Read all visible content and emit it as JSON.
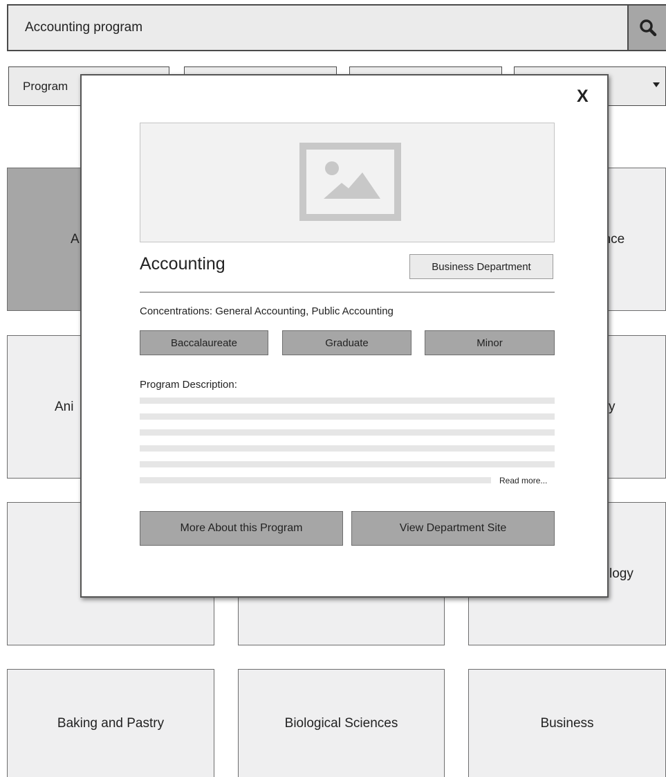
{
  "search": {
    "value": "Accounting program",
    "button_icon": "search-icon"
  },
  "filters": [
    {
      "label": "Program"
    },
    {
      "label": ""
    },
    {
      "label": ""
    },
    {
      "label": "",
      "icon": "chevron-down-icon"
    }
  ],
  "tiles": [
    {
      "label": "A",
      "selected": true
    },
    {
      "label": "ence",
      "selected": false
    },
    {
      "label": "Ani",
      "selected": false
    },
    {
      "label": "y",
      "selected": false
    },
    {
      "label": "",
      "selected": false
    },
    {
      "label": "",
      "selected": false
    },
    {
      "label": "logy",
      "selected": false
    },
    {
      "label": "Baking and Pastry",
      "selected": false
    },
    {
      "label": "Biological Sciences",
      "selected": false
    },
    {
      "label": "Business",
      "selected": false
    }
  ],
  "modal": {
    "close_label": "X",
    "image_icon": "image-placeholder-icon",
    "title": "Accounting",
    "department": "Business Department",
    "concentrations": "Concentrations: General Accounting, Public Accounting",
    "degrees": [
      "Baccalaureate",
      "Graduate",
      "Minor"
    ],
    "description_label": "Program Description:",
    "read_more": "Read more...",
    "buttons": {
      "more_about": "More About this Program",
      "view_department": "View Department Site"
    }
  },
  "colors": {
    "tile_background": "#efeff0",
    "selected_tile": "#a6a6a6",
    "button_gray": "#a6a6a6",
    "border_dark": "#4a4a4a",
    "placeholder_line": "#e6e6e6"
  }
}
